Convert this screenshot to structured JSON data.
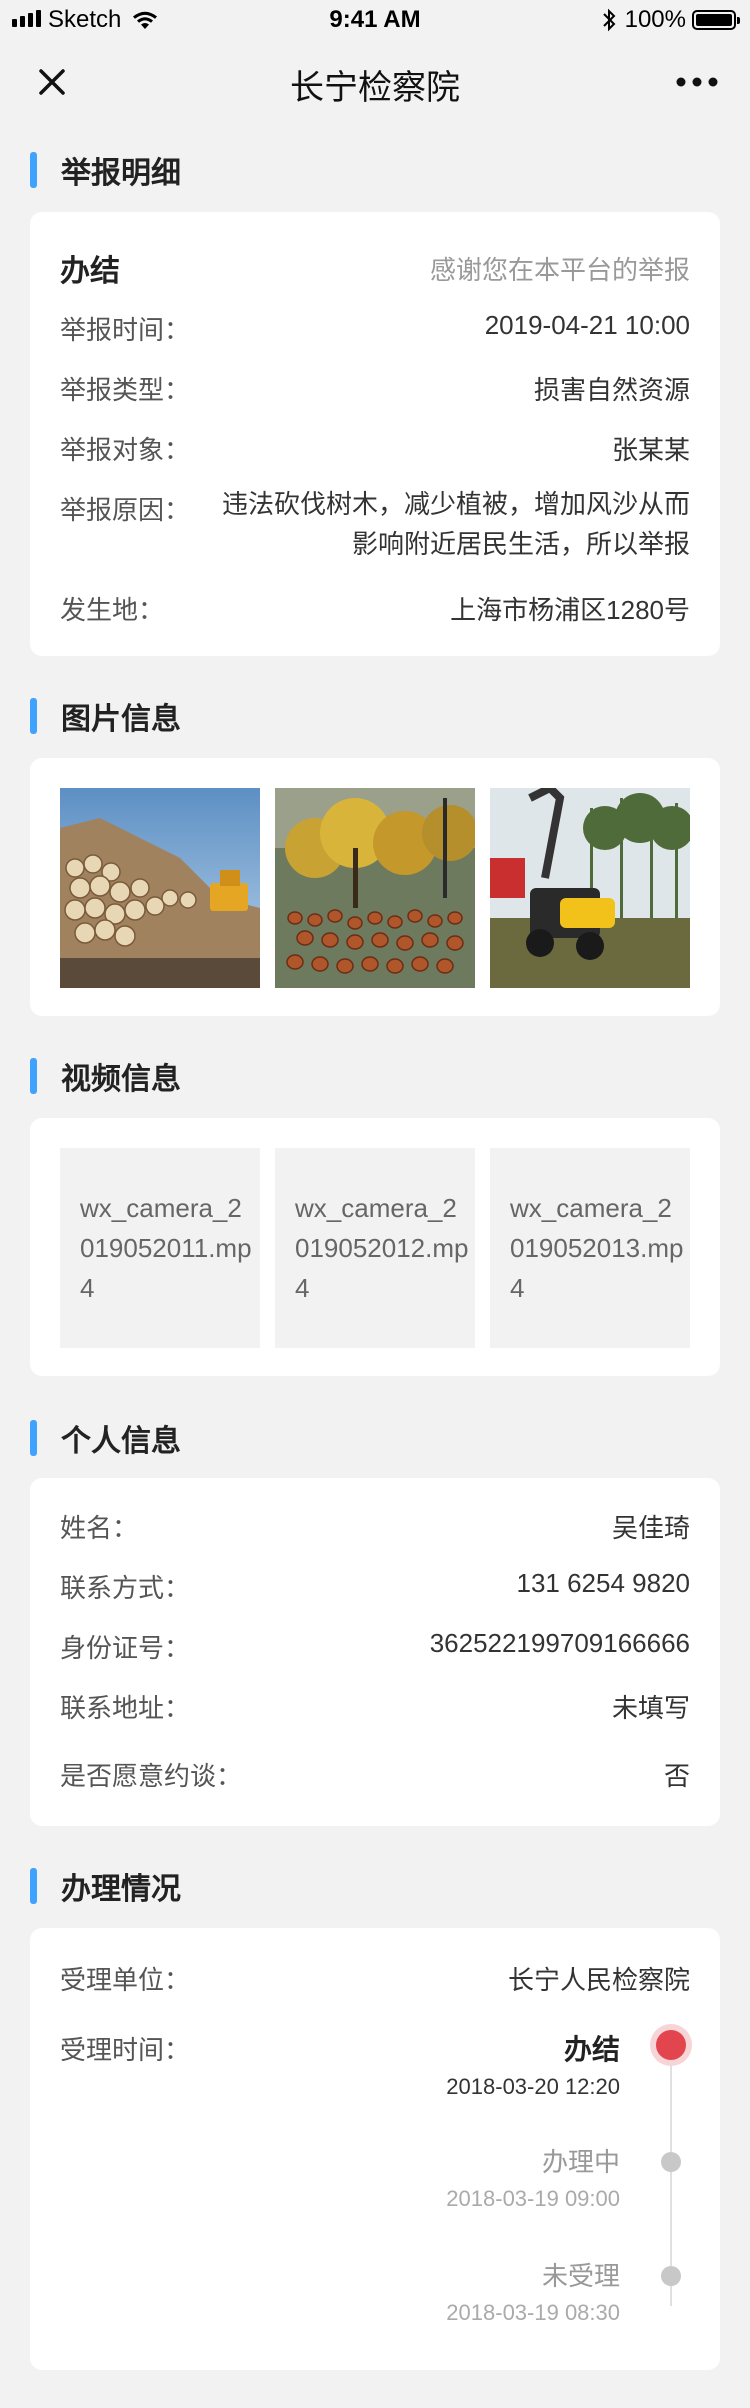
{
  "status_bar": {
    "carrier": "Sketch",
    "time": "9:41 AM",
    "battery": "100%"
  },
  "nav": {
    "title": "长宁检察院",
    "close_icon": "close-icon",
    "more_icon": "more-icon"
  },
  "report": {
    "section_title": "举报明细",
    "status": "办结",
    "thanks": "感谢您在本平台的举报",
    "rows": [
      {
        "label": "举报时间：",
        "value": "2019-04-21 10:00"
      },
      {
        "label": "举报类型：",
        "value": "损害自然资源"
      },
      {
        "label": "举报对象：",
        "value": "张某某"
      },
      {
        "label": "举报原因：",
        "value": "违法砍伐树木，减少植被，增加风沙从而影响附近居民生活，所以举报"
      },
      {
        "label": "发生地：",
        "value": "上海市杨浦区1280号"
      }
    ]
  },
  "images": {
    "section_title": "图片信息",
    "count": 3
  },
  "videos": {
    "section_title": "视频信息",
    "files": [
      "wx_camera_2019052011.mp4",
      "wx_camera_2019052012.mp4",
      "wx_camera_2019052013.mp4"
    ]
  },
  "personal": {
    "section_title": "个人信息",
    "rows": [
      {
        "label": "姓名：",
        "value": "吴佳琦"
      },
      {
        "label": "联系方式：",
        "value": "131 6254 9820"
      },
      {
        "label": "身份证号：",
        "value": "362522199709166666"
      },
      {
        "label": "联系地址：",
        "value": "未填写"
      },
      {
        "label": "是否愿意约谈：",
        "value": "否"
      }
    ]
  },
  "handling": {
    "section_title": "办理情况",
    "unit_label": "受理单位：",
    "unit_value": "长宁人民检察院",
    "time_label": "受理时间：",
    "timeline": [
      {
        "status": "办结",
        "time": "2018-03-20 12:20",
        "active": true
      },
      {
        "status": "办理中",
        "time": "2018-03-19 09:00",
        "active": false
      },
      {
        "status": "未受理",
        "time": "2018-03-19 08:30",
        "active": false
      }
    ]
  },
  "colors": {
    "accent": "#3fa2ff",
    "active_dot": "#e2454d",
    "background": "#f2f2f2"
  }
}
